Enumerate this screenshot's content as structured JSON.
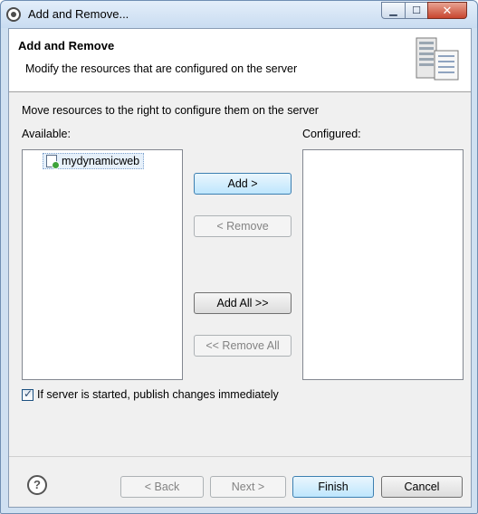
{
  "window": {
    "title": "Add and Remove...",
    "minimize_icon": "minimize-icon",
    "maximize_icon": "maximize-icon",
    "close_icon": "close-icon"
  },
  "header": {
    "title": "Add and Remove",
    "description": "Modify the resources that are configured on the server",
    "image_icon": "server-icon"
  },
  "main": {
    "instruction": "Move resources to the right to configure them on the server",
    "available_label": "Available:",
    "configured_label": "Configured:",
    "available_items": [
      {
        "label": "mydynamicweb",
        "icon": "web-project-icon"
      }
    ],
    "configured_items": []
  },
  "buttons": {
    "add": "Add >",
    "remove": "< Remove",
    "add_all": "Add All >>",
    "remove_all": "<< Remove All"
  },
  "publish_checkbox": {
    "label": "If server is started, publish changes immediately",
    "checked": true
  },
  "footer": {
    "help_icon": "help-icon",
    "back": "< Back",
    "next": "Next >",
    "finish": "Finish",
    "cancel": "Cancel"
  }
}
